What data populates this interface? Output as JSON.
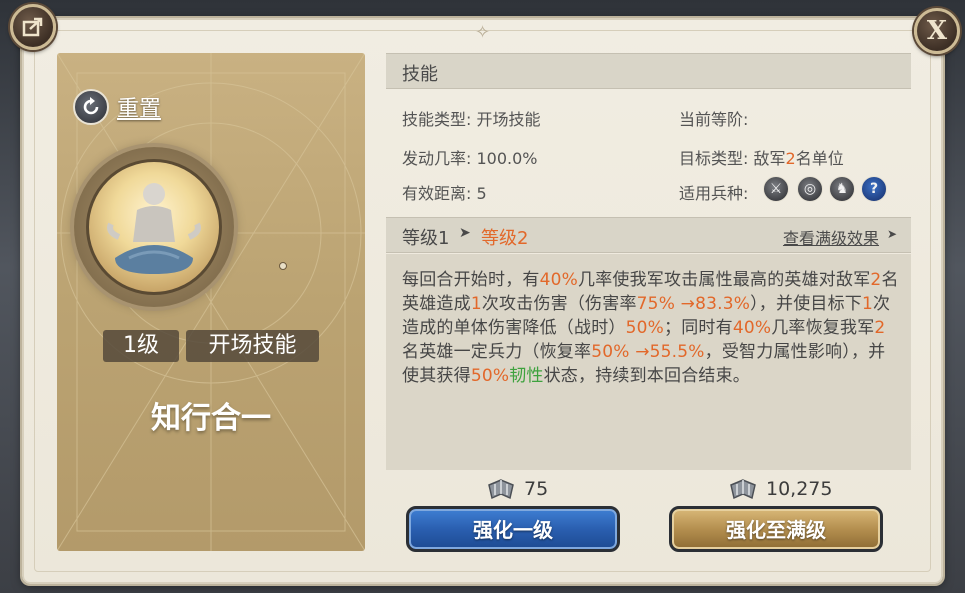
{
  "header": {
    "share_icon": "share-icon",
    "close_label": "X"
  },
  "skill_card": {
    "reset_label": "重置",
    "level_badge": "1级",
    "type_badge": "开场技能",
    "skill_name": "知行合一",
    "portrait_icon": "meditating-monk-portrait"
  },
  "skill_section": {
    "title": "技能",
    "skill_type_label": "技能类型:",
    "skill_type_value": "开场技能",
    "current_rank_label": "当前等阶:",
    "current_rank_value": "",
    "trigger_rate_label": "发动几率:",
    "trigger_rate_value": "100.0%",
    "target_type_label": "目标类型:",
    "target_type_prefix": "敌军",
    "target_type_count": "2",
    "target_type_suffix": "名单位",
    "range_label": "有效距离:",
    "range_value": "5",
    "troop_label": "适用兵种:",
    "troop_icons": [
      "sword-icon",
      "bow-target-icon",
      "horse-icon",
      "help-icon"
    ]
  },
  "level_section": {
    "current_level": "等级1",
    "next_level": "等级2",
    "view_max_label": "查看满级效果"
  },
  "description": {
    "p1": "每回合开始时，有",
    "v1": "40%",
    "p2": "几率使我军攻击属性最高的英雄对敌军",
    "v2": "2",
    "p3": "名英雄造成",
    "v3": "1",
    "p4": "次攻击伤害（伤害率",
    "v4": "75% →83.3%",
    "p5": "），并使目标下",
    "v5": "1",
    "p6": "次造成的单体伤害降低（战时）",
    "v6": "50%",
    "p7": "；同时有",
    "v7": "40%",
    "p8": "几率恢复我军",
    "v8": "2",
    "p9": "名英雄一定兵力（恢复率",
    "v9": "50% →55.5%",
    "p10": "，受智力属性影响），并使其获得",
    "v10": "50%",
    "g1": "韧性",
    "p11": "状态，持续到本回合结束。"
  },
  "upgrade": {
    "cost_one": "75",
    "cost_max": "10,275",
    "cost_icon": "skill-book-icon",
    "btn_one_label": "强化一级",
    "btn_max_label": "强化至满级"
  },
  "colors": {
    "highlight_orange": "#e2682a",
    "highlight_green": "#3ea23e",
    "button_blue": "#2a5fb0",
    "button_gold": "#b48f4f"
  }
}
